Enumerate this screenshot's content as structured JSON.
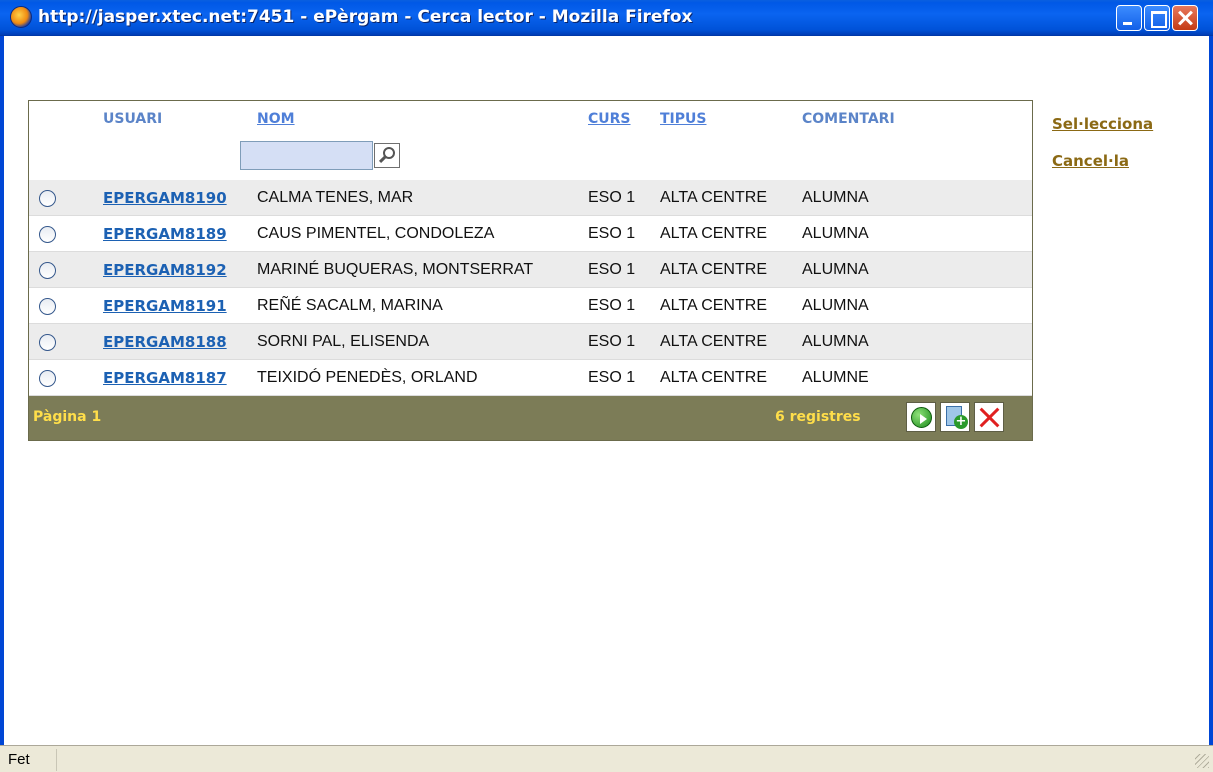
{
  "window": {
    "title": "http://jasper.xtec.net:7451 - ePèrgam - Cerca lector - Mozilla Firefox"
  },
  "table": {
    "headers": {
      "usuari": "USUARI",
      "nom": "NOM",
      "curs": "CURS",
      "tipus": "TIPUS",
      "comentari": "COMENTARI"
    },
    "search": {
      "value": "",
      "placeholder": ""
    },
    "rows": [
      {
        "usuari": "EPERGAM8190",
        "nom": "CALMA TENES, MAR",
        "curs": "ESO 1",
        "tipus": "ALTA CENTRE",
        "comentari": "ALUMNA"
      },
      {
        "usuari": "EPERGAM8189",
        "nom": "CAUS PIMENTEL, CONDOLEZA",
        "curs": "ESO 1",
        "tipus": "ALTA CENTRE",
        "comentari": "ALUMNA"
      },
      {
        "usuari": "EPERGAM8192",
        "nom": "MARINÉ BUQUERAS, MONTSERRAT",
        "curs": "ESO 1",
        "tipus": "ALTA CENTRE",
        "comentari": "ALUMNA"
      },
      {
        "usuari": "EPERGAM8191",
        "nom": "REÑÉ SACALM, MARINA",
        "curs": "ESO 1",
        "tipus": "ALTA CENTRE",
        "comentari": "ALUMNA"
      },
      {
        "usuari": "EPERGAM8188",
        "nom": "SORNI PAL, ELISENDA",
        "curs": "ESO 1",
        "tipus": "ALTA CENTRE",
        "comentari": "ALUMNA"
      },
      {
        "usuari": "EPERGAM8187",
        "nom": "TEIXIDÓ PENEDÈS, ORLAND",
        "curs": "ESO 1",
        "tipus": "ALTA CENTRE",
        "comentari": "ALUMNE"
      }
    ],
    "footer": {
      "page": "Pàgina 1",
      "count": "6 registres"
    }
  },
  "actions": {
    "select": "Sel·lecciona",
    "cancel": "Cancel·la"
  },
  "statusbar": {
    "text": "Fet"
  },
  "icons": {
    "title": "firefox-icon",
    "search": "magnifier-icon",
    "go": "go-arrow-icon",
    "add": "add-document-icon",
    "delete": "delete-x-icon"
  }
}
